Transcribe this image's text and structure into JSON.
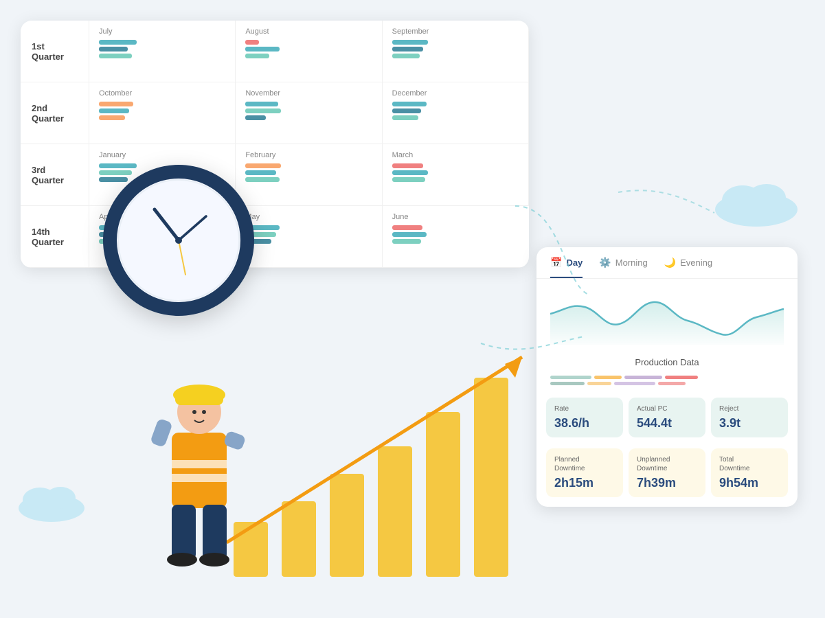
{
  "quarterly_panel": {
    "quarters": [
      {
        "label": "1st\nQuarter"
      },
      {
        "label": "2nd\nQuarter"
      },
      {
        "label": "3rd\nQuarter"
      },
      {
        "label": "14th\nQuarter"
      }
    ],
    "months": [
      {
        "name": "July",
        "bars": [
          {
            "color": "#5bb8c4",
            "width": 55
          },
          {
            "color": "#4a90a4",
            "width": 42
          },
          {
            "color": "#7dd0c0",
            "width": 48
          }
        ]
      },
      {
        "name": "August",
        "bars": [
          {
            "color": "#f08080",
            "width": 20
          },
          {
            "color": "#5bb8c4",
            "width": 50
          },
          {
            "color": "#f9a870",
            "width": 35
          }
        ]
      },
      {
        "name": "September",
        "bars": [
          {
            "color": "#5bb8c4",
            "width": 52
          },
          {
            "color": "#4a90a4",
            "width": 45
          },
          {
            "color": "#7dd0c0",
            "width": 40
          }
        ]
      },
      {
        "name": "Octomber",
        "bars": [
          {
            "color": "#f9a870",
            "width": 50
          },
          {
            "color": "#5bb8c4",
            "width": 44
          },
          {
            "color": "#f9a870",
            "width": 38
          }
        ]
      },
      {
        "name": "November",
        "bars": [
          {
            "color": "#5bb8c4",
            "width": 48
          },
          {
            "color": "#7dd0c0",
            "width": 52
          },
          {
            "color": "#4a90a4",
            "width": 30
          }
        ]
      },
      {
        "name": "December",
        "bars": [
          {
            "color": "#5bb8c4",
            "width": 50
          },
          {
            "color": "#4a90a4",
            "width": 42
          },
          {
            "color": "#7dd0c0",
            "width": 38
          }
        ]
      },
      {
        "name": "January",
        "bars": [
          {
            "color": "#5bb8c4",
            "width": 55
          },
          {
            "color": "#7dd0c0",
            "width": 48
          },
          {
            "color": "#4a90a4",
            "width": 42
          }
        ]
      },
      {
        "name": "February",
        "bars": [
          {
            "color": "#f9a870",
            "width": 52
          },
          {
            "color": "#5bb8c4",
            "width": 45
          },
          {
            "color": "#7dd0c0",
            "width": 50
          }
        ]
      },
      {
        "name": "March",
        "bars": [
          {
            "color": "#f08080",
            "width": 45
          },
          {
            "color": "#5bb8c4",
            "width": 52
          },
          {
            "color": "#7dd0c0",
            "width": 48
          }
        ]
      },
      {
        "name": "April",
        "bars": [
          {
            "color": "#5bb8c4",
            "width": 44
          },
          {
            "color": "#4a90a4",
            "width": 38
          },
          {
            "color": "#7dd0c0",
            "width": 50
          }
        ]
      },
      {
        "name": "May",
        "bars": [
          {
            "color": "#5bb8c4",
            "width": 50
          },
          {
            "color": "#7dd0c0",
            "width": 45
          },
          {
            "color": "#4a90a4",
            "width": 38
          }
        ]
      },
      {
        "name": "June",
        "bars": [
          {
            "color": "#f08080",
            "width": 44
          },
          {
            "color": "#5bb8c4",
            "width": 50
          },
          {
            "color": "#7dd0c0",
            "width": 42
          }
        ]
      }
    ]
  },
  "production_panel": {
    "tabs": [
      {
        "label": "Day",
        "icon": "📅",
        "active": true
      },
      {
        "label": "Morning",
        "icon": "⚙️",
        "active": false
      },
      {
        "label": "Evening",
        "icon": "🌙",
        "active": false
      }
    ],
    "chart_label": "Production Data",
    "legend": [
      {
        "color": "#b0d4cc",
        "width": 60
      },
      {
        "color": "#f9c46b",
        "width": 40
      },
      {
        "color": "#c8b4d8",
        "width": 55
      },
      {
        "color": "#f08080",
        "width": 48
      }
    ],
    "legend2": [
      {
        "color": "#a8c8c0",
        "width": 50
      },
      {
        "color": "#f9d498",
        "width": 35
      },
      {
        "color": "#d4c4e4",
        "width": 60
      },
      {
        "color": "#f4a8a8",
        "width": 40
      }
    ],
    "stats_top": [
      {
        "label": "Rate",
        "value": "38.6/h",
        "color": "teal"
      },
      {
        "label": "Actual PC",
        "value": "544.4t",
        "color": "teal"
      },
      {
        "label": "Reject",
        "value": "3.9t",
        "color": "teal"
      }
    ],
    "stats_bottom": [
      {
        "label": "Planned\nDowntime",
        "value": "2h15m",
        "color": "yellow"
      },
      {
        "label": "Unplanned\nDowntime",
        "value": "7h39m",
        "color": "yellow"
      },
      {
        "label": "Total\nDowntime",
        "value": "9h54m",
        "color": "yellow"
      }
    ]
  }
}
